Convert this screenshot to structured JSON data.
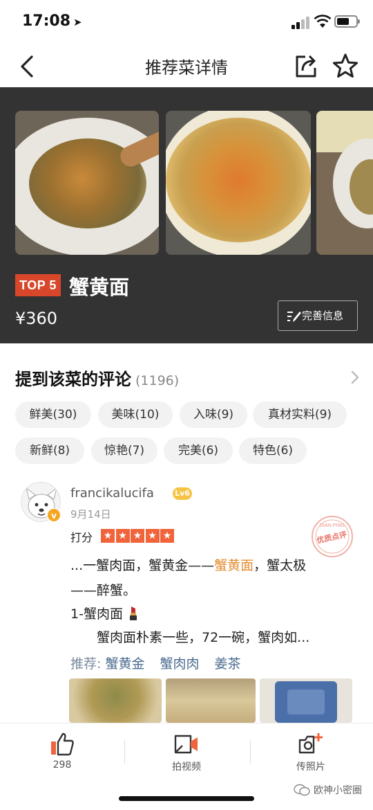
{
  "status_bar": {
    "time": "17:08",
    "location_arrow": "➤"
  },
  "nav": {
    "title": "推荐菜详情",
    "icons": [
      "back-icon",
      "share-icon",
      "star-icon"
    ]
  },
  "dish": {
    "top_badge": "TOP 5",
    "name": "蟹黄面",
    "price": "¥360",
    "improve_button": "完善信息",
    "photo_count_visible": 3
  },
  "reviews": {
    "title": "提到该菜的评论",
    "count": "(1196)",
    "tags": [
      "鲜美(30)",
      "美味(10)",
      "入味(9)",
      "真材实料(9)",
      "新鲜(8)",
      "惊艳(7)",
      "完美(6)",
      "特色(6)"
    ]
  },
  "review": {
    "username": "francikalucifa",
    "level": "Lv6",
    "verified": "v",
    "date": "9月14日",
    "rating_label": "打分",
    "stars": 5,
    "stamp_text": "优质点评",
    "stamp_sub": "DIAN PING",
    "line1_pre": "...一蟹肉面，蟹黄金——",
    "line1_highlight": "蟹黄面",
    "line1_post": "，蟹太极",
    "line2": "——醉蟹。",
    "line3": "1-蟹肉面",
    "line4": "蟹肉面朴素一些，72一碗，蟹肉如...",
    "recommend_label": "推荐: ",
    "recommend_dishes": [
      "蟹黄金",
      "蟹肉肉",
      "姜茶"
    ]
  },
  "bottom_bar": {
    "like_count": "298",
    "video_label": "拍视频",
    "photo_label": "传照片"
  },
  "watermark": "欧神小密圈",
  "colors": {
    "header_bg": "#333333",
    "badge_red": "#d9472b",
    "highlight_orange": "#e38b2f",
    "star_orange": "#f0643c",
    "link_blue": "#4a6a8f"
  }
}
